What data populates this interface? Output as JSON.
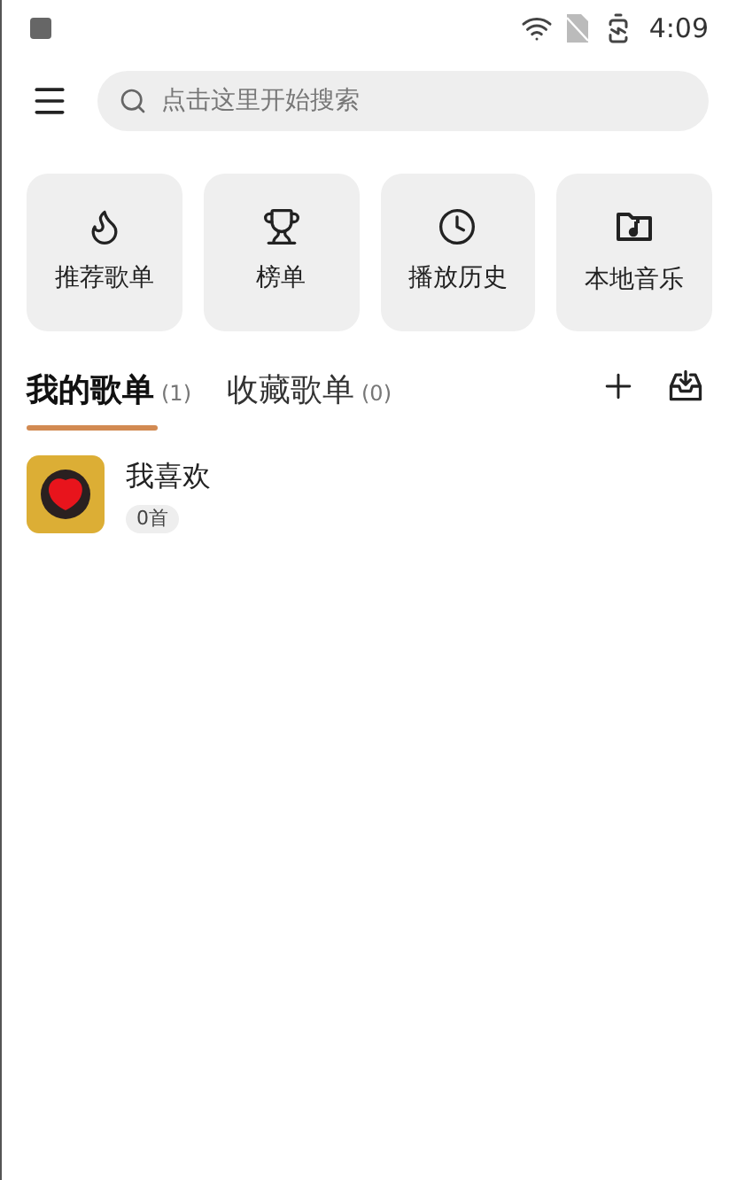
{
  "status_bar": {
    "time": "4:09"
  },
  "search": {
    "placeholder": "点击这里开始搜索"
  },
  "quick_links": [
    {
      "kind": "flame",
      "label": "推荐歌单"
    },
    {
      "kind": "trophy",
      "label": "榜单"
    },
    {
      "kind": "clock",
      "label": "播放历史"
    },
    {
      "kind": "folder",
      "label": "本地音乐"
    }
  ],
  "tabs": [
    {
      "label": "我的歌单",
      "count": "(1)",
      "selected": true
    },
    {
      "label": "收藏歌单",
      "count": "(0)",
      "selected": false
    }
  ],
  "playlists": [
    {
      "name": "我喜欢",
      "count": "0首"
    }
  ]
}
